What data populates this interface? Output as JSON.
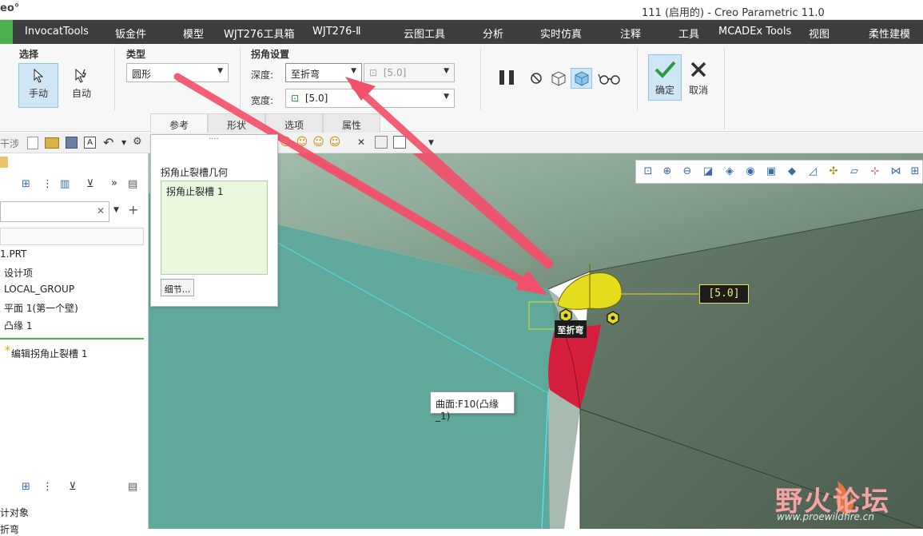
{
  "titlebar": {
    "logo": "eo°",
    "title": "111 (启用的) - Creo Parametric 11.0"
  },
  "menus": [
    "InvocatTools",
    "钣金件",
    "模型",
    "WJT276工具箱",
    "WJT276-Ⅱ",
    "云图工具",
    "分析",
    "实时仿真",
    "注释",
    "工具",
    "MCADEx Tools",
    "视图",
    "柔性建模"
  ],
  "ribbon": {
    "select_group": {
      "title": "选择",
      "manual": "手动",
      "auto": "自动"
    },
    "type_group": {
      "title": "类型",
      "value": "圆形"
    },
    "corner_group": {
      "title": "拐角设置",
      "depth_label": "深度:",
      "depth_value": "至折弯",
      "depth_dim": "[5.0]",
      "width_label": "宽度:",
      "width_value": "[5.0]"
    },
    "confirm": "确定",
    "cancel": "取消",
    "tabs": [
      "参考",
      "形状",
      "选项",
      "属性"
    ]
  },
  "toolbar": {
    "interference": "干涉"
  },
  "popup": {
    "title": "拐角止裂槽几何",
    "list_item": "拐角止裂槽 1",
    "details_button": "细节..."
  },
  "model_tree": {
    "items": [
      "1.PRT",
      "设计项",
      "LOCAL_GROUP",
      "平面 1(第一个壁)",
      "凸缘 1"
    ],
    "editing": "编辑拐角止裂槽 1",
    "bottom_label": "计对象",
    "bottom_label2": "折弯"
  },
  "viewport": {
    "dimension_tag": "[5.0]",
    "depth_tag": "至折弯",
    "tooltip": "曲面:F10(凸缘_1)"
  },
  "watermark": {
    "brand": "野火论坛",
    "url": "www.proewildfire.cn"
  },
  "colors": {
    "menubar": "#3d3d3d",
    "accent_green": "#4caf50",
    "model_teal": "#5fa89b",
    "relief_yellow": "#e6dc1e",
    "relief_red": "#d41f3c",
    "arrow": "#f0506a"
  }
}
